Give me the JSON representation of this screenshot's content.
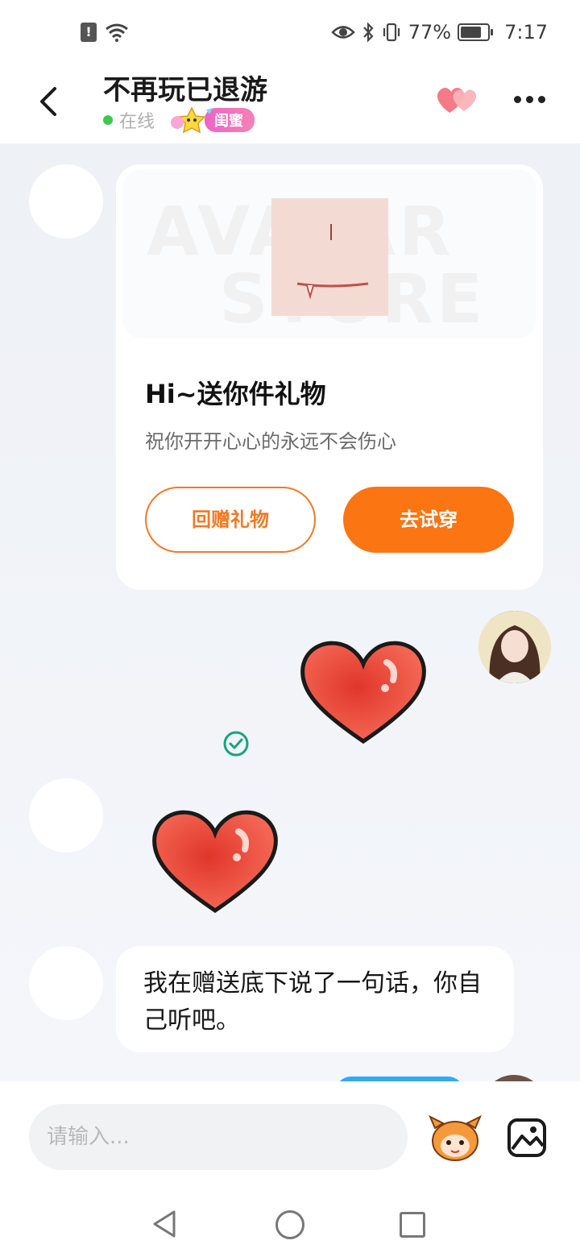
{
  "status_bar": {
    "battery": "77%",
    "battery_level": 0.77,
    "time": "7:17"
  },
  "header": {
    "title": "不再玩已退游",
    "status": "在线",
    "relationship_badge": "闺蜜"
  },
  "gift_card": {
    "title": "Hi~送你件礼物",
    "description": "祝你开开心心的永远不会伤心",
    "watermark_line1": "AVATAR",
    "watermark_line2": "STORE",
    "return_gift_label": "回赠礼物",
    "try_on_label": "去试穿"
  },
  "messages": [
    {
      "from": "me",
      "type": "sticker",
      "sticker": "red-heart"
    },
    {
      "from": "friend",
      "type": "sticker",
      "sticker": "red-heart"
    },
    {
      "from": "friend",
      "type": "text",
      "text": "我在赠送底下说了一句话，你自己听吧。"
    }
  ],
  "input": {
    "placeholder": "请输入..."
  },
  "colors": {
    "accent_orange": "#fb7512",
    "online_green": "#3ec94d",
    "badge_pink": "#ee63c7",
    "chat_bg": "#f3f5f9"
  }
}
